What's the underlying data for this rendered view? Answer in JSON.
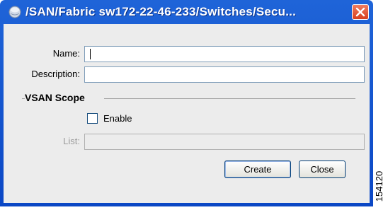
{
  "window": {
    "title": "/SAN/Fabric sw172-22-46-233/Switches/Secu..."
  },
  "form": {
    "name_label": "Name:",
    "name_value": "",
    "description_label": "Description:",
    "description_value": "",
    "vsan_scope_title": "VSAN Scope",
    "enable_label": "Enable",
    "enable_checked": false,
    "list_label": "List:",
    "list_value": "",
    "list_enabled": false
  },
  "buttons": {
    "create": "Create",
    "close": "Close"
  },
  "figure_id": "154120",
  "icons": {
    "title": "app-globe-icon",
    "close": "close-icon"
  },
  "colors": {
    "titlebar": "#0b47c5",
    "close_button": "#d8401f",
    "client_bg": "#ececec",
    "field_border": "#7f9db9"
  }
}
